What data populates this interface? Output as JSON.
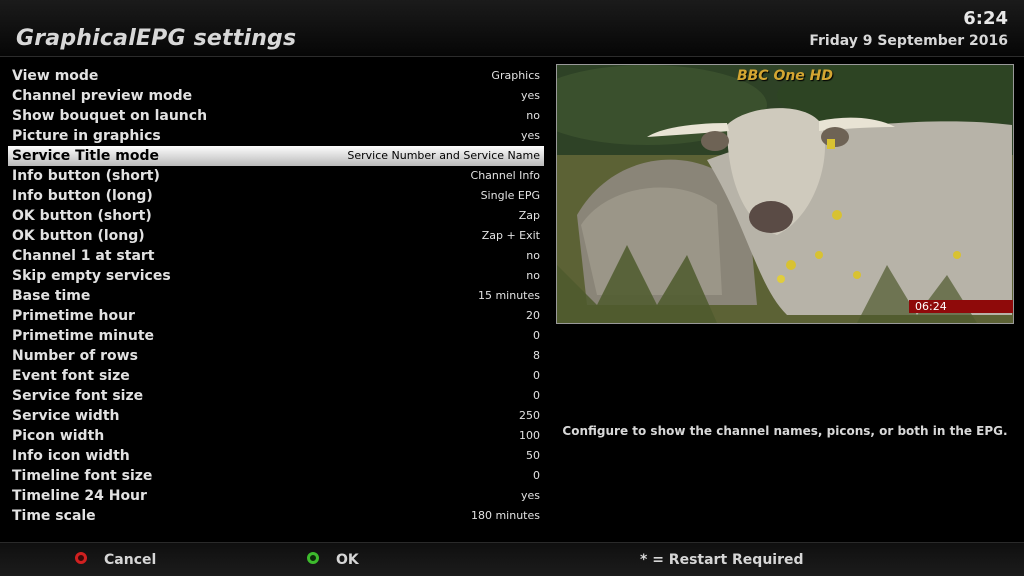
{
  "header": {
    "title": "GraphicalEPG settings",
    "clock": "6:24",
    "date": "Friday  9 September 2016"
  },
  "settings": [
    {
      "label": "View mode",
      "value": "Graphics"
    },
    {
      "label": "Channel preview mode",
      "value": "yes"
    },
    {
      "label": "Show bouquet on launch",
      "value": "no"
    },
    {
      "label": "Picture in graphics",
      "value": "yes"
    },
    {
      "label": "Service Title mode",
      "value": "Service Number and Service Name",
      "selected": true
    },
    {
      "label": "Info button (short)",
      "value": "Channel Info"
    },
    {
      "label": "Info button (long)",
      "value": "Single EPG"
    },
    {
      "label": "OK button (short)",
      "value": "Zap"
    },
    {
      "label": "OK button (long)",
      "value": "Zap + Exit"
    },
    {
      "label": "Channel 1 at start",
      "value": "no"
    },
    {
      "label": "Skip empty services",
      "value": "no"
    },
    {
      "label": "Base time",
      "value": "15 minutes"
    },
    {
      "label": "Primetime hour",
      "value": "20"
    },
    {
      "label": "Primetime minute",
      "value": "0"
    },
    {
      "label": "Number of rows",
      "value": "8"
    },
    {
      "label": "Event font size",
      "value": "0"
    },
    {
      "label": "Service font size",
      "value": "0"
    },
    {
      "label": "Service width",
      "value": "250"
    },
    {
      "label": "Picon width",
      "value": "100"
    },
    {
      "label": "Info icon width",
      "value": "50"
    },
    {
      "label": "Timeline font size",
      "value": "0"
    },
    {
      "label": "Timeline 24 Hour",
      "value": "yes"
    },
    {
      "label": "Time scale",
      "value": "180 minutes"
    }
  ],
  "preview": {
    "channel": "BBC One HD",
    "time": "06:24"
  },
  "description": "Configure to show the channel names, picons, or both in the EPG.",
  "footer": {
    "cancel_label": "Cancel",
    "ok_label": "OK",
    "restart_note": "* = Restart Required"
  },
  "icons": {
    "red_button": "red-circle-icon",
    "green_button": "green-circle-icon"
  },
  "colors": {
    "red_key": "#d02020",
    "green_key": "#3dbb2d",
    "channel_name": "#d4a632",
    "time_bar": "#8f0a0a"
  }
}
